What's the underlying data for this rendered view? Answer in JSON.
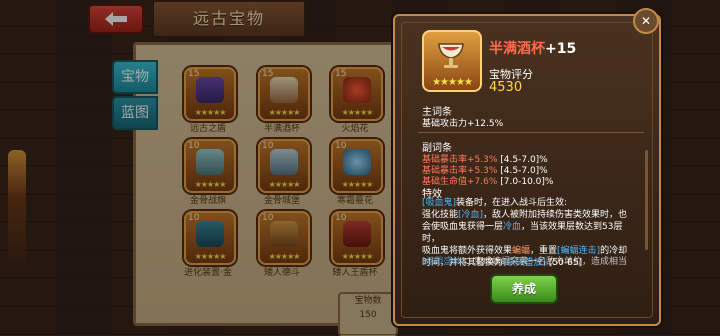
{
  "header": {
    "title": "远古宝物",
    "back_label": ""
  },
  "tabs": [
    {
      "label": "宝物"
    },
    {
      "label": "蓝图"
    }
  ],
  "grid": {
    "cards": [
      {
        "level": "15",
        "name": "远古之盾",
        "stars": "★★★★★"
      },
      {
        "level": "15",
        "name": "半满酒杯",
        "stars": "★★★★★"
      },
      {
        "level": "15",
        "name": "火焰花",
        "stars": "★★★★★"
      },
      {
        "level": "10",
        "name": "金骨战旗",
        "stars": "★★★★★"
      },
      {
        "level": "10",
        "name": "金骨城堡",
        "stars": "★★★★★"
      },
      {
        "level": "10",
        "name": "寒霜蔓花",
        "stars": "★★★★★"
      },
      {
        "level": "10",
        "name": "进化装置·金",
        "stars": "★★★★★"
      },
      {
        "level": "10",
        "name": "矮人德斗",
        "stars": "★★★★★"
      },
      {
        "level": "10",
        "name": "矮人王盾杯",
        "stars": "★★★★★"
      }
    ],
    "count_label": "宝物数",
    "count_value": "150"
  },
  "popup": {
    "item_name": "半满酒杯",
    "item_plus": "+15",
    "stars": "★★★★★",
    "score_label": "宝物评分",
    "score_value": "4530",
    "main_heading": "主词条",
    "main_stat": "基础攻击力+12.5%",
    "sub_heading": "副词条",
    "sub_stats": [
      {
        "key": "基础暴击率+5.3%",
        "range": "[4.5-7.0]%"
      },
      {
        "key": "基础暴击率+5.3%",
        "range": "[4.5-7.0]%"
      },
      {
        "key": "基础生命值+7.6%",
        "range": "[7.0-10.0]%"
      }
    ],
    "effect_heading": "特效",
    "effect_line1a": "[吸血鬼]",
    "effect_line1b": "装备时，在进入战斗后生效:",
    "effect_line2a": "强化技能",
    "effect_line2b": "[冷血]",
    "effect_line2c": "，敌人被附加持续伤害类效果时，也",
    "effect_line3a": "会使吸血鬼获得一层",
    "effect_line3b": "冷血",
    "effect_line3c": "，当该效果层数达到53层时，",
    "effect_line4a": "吸血鬼将额外获得效果",
    "effect_line4b": "蝙蝠",
    "effect_line4c": "，重置",
    "effect_line4d": "[蝙蝠连击]",
    "effect_line4e": "的冷却",
    "effect_line5a": "时间，并将其替换为",
    "effect_line5b": "[杀戮盛放]",
    "effect_line5c": "[50-65]",
    "effect_tail_a": "[杀戮盛放]",
    "effect_tail_b": "：变成蝙蝠突袭一名敌方单位，造成相当",
    "craft_label": "养成",
    "colors": {
      "accent": "#ff6a4a",
      "score": "#ffd84a",
      "highlight": "#4ab8ff",
      "button": "#5ab232"
    }
  }
}
